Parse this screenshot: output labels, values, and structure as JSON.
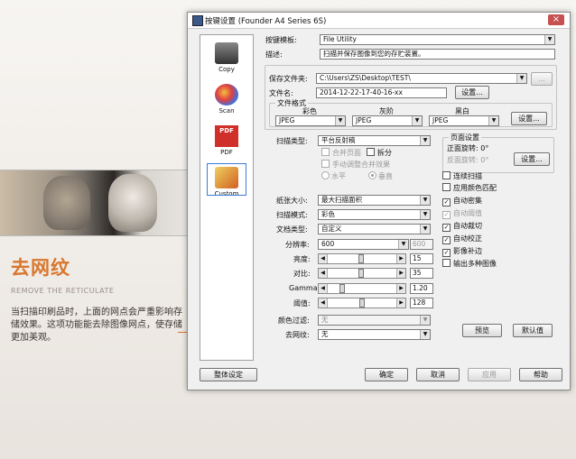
{
  "promo": {
    "title_cn": "去网纹",
    "title_en": "REMOVE THE RETICULATE",
    "description": "当扫描印刷品时，上面的网点会严重影响存储效果。这项功能能去除图像网点，使存储更加美观。"
  },
  "window": {
    "title": "按键设置 (Founder A4 Series 6S)",
    "close_label": "×"
  },
  "sidebar": {
    "items": [
      {
        "label": "Copy",
        "icon": "printer-icon"
      },
      {
        "label": "Scan",
        "icon": "palette-icon"
      },
      {
        "label": "PDF",
        "icon": "pdf-icon",
        "icon_text": "PDF"
      },
      {
        "label": "Custom",
        "icon": "custom-icon",
        "selected": true
      }
    ]
  },
  "top": {
    "template_label": "按键模板:",
    "template_value": "File Utility",
    "desc_label": "描述:",
    "desc_value": "扫描并保存图像到您的存贮装置。"
  },
  "save": {
    "folder_label": "保存文件夹:",
    "folder_value": "C:\\Users\\ZS\\Desktop\\TEST\\",
    "browse_label": "...",
    "filename_label": "文件名:",
    "filename_value": "2014-12-22-17-40-16-xx",
    "settings_label": "设置...",
    "format_group": "文件格式",
    "format_color_label": "彩色",
    "format_gray_label": "灰阶",
    "format_bw_label": "黑白",
    "format_color": "JPEG",
    "format_gray": "JPEG",
    "format_bw": "JPEG",
    "format_settings_label": "设置..."
  },
  "scan": {
    "type_label": "扫描类型:",
    "type_value": "平台反射稿",
    "merge_label": "合并页面",
    "split_label": "拆分",
    "manual_merge_label": "手动调整合并效果",
    "horizontal_label": "水平",
    "vertical_label": "垂直",
    "paper_label": "纸张大小:",
    "paper_value": "最大扫描面积",
    "mode_label": "扫描模式:",
    "mode_value": "彩色",
    "doctype_label": "文档类型:",
    "doctype_value": "自定义",
    "resolution_label": "分辨率:",
    "resolution_value": "600",
    "resolution_aux": "600",
    "brightness_label": "亮度:",
    "brightness_value": "15",
    "contrast_label": "对比:",
    "contrast_value": "35",
    "gamma_label": "Gamma:",
    "gamma_value": "1.20",
    "threshold_label": "阈值:",
    "threshold_value": "128",
    "color_filter_label": "颜色过滤:",
    "color_filter_value": "无",
    "descreen_label": "去网纹:",
    "descreen_value": "无"
  },
  "page_settings": {
    "group_label": "页面设置",
    "front_rotate": "正面旋转: 0°",
    "back_rotate": "反面旋转: 0°",
    "settings_label": "设置..."
  },
  "options": [
    {
      "label": "连续扫描",
      "checked": false,
      "disabled": false
    },
    {
      "label": "应用颜色匹配",
      "checked": false,
      "disabled": false
    },
    {
      "label": "自动密集",
      "checked": true,
      "disabled": false
    },
    {
      "label": "自动阈值",
      "checked": true,
      "disabled": true
    },
    {
      "label": "自动裁切",
      "checked": true,
      "disabled": false
    },
    {
      "label": "自动校正",
      "checked": true,
      "disabled": false
    },
    {
      "label": "影像补边",
      "checked": true,
      "disabled": false
    },
    {
      "label": "输出多种图像",
      "checked": false,
      "disabled": false
    }
  ],
  "buttons": {
    "preview": "预览",
    "default": "默认值",
    "global": "整体设定",
    "ok": "确定",
    "cancel": "取消",
    "apply": "应用",
    "help": "帮助"
  },
  "sliders": {
    "brightness": 0.48,
    "contrast": 0.49,
    "gamma": 0.2,
    "threshold": 0.5
  },
  "colors": {
    "accent": "#d9772e",
    "selection": "#3d7bd6"
  }
}
